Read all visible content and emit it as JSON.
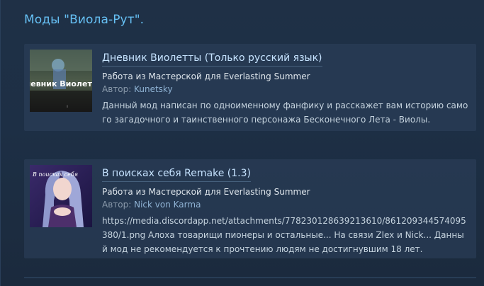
{
  "section": {
    "title": "Моды \"Виола-Рут\"."
  },
  "mods": [
    {
      "title": "Дневник Виолетты (Только русский язык)",
      "workshop": "Работа из Мастерской для Everlasting Summer",
      "author_label": "Автор:",
      "author": "Kunetsky",
      "description": "Данный мод написан по одноименному фанфику и расскажет вам историю самого загадочного и таинственного персонажа Бесконечного Лета - Виолы.",
      "thumb_text": "Дневник Виолетты"
    },
    {
      "title": "В поисках себя Remake (1.3)",
      "workshop": "Работа из Мастерской для Everlasting Summer",
      "author_label": "Автор:",
      "author": "Nick von Karma",
      "description": "https://media.discordapp.net/attachments/778230128639213610/861209344574095380/1.png Алоха товарищи пионеры и остальные... На связи Zlex и Nick... Данный мод не рекомендуется к прочтению людям не достигнувшим 18 лет.",
      "thumb_text": "В поисках себя"
    }
  ],
  "colors": {
    "accent": "#66c0f4",
    "background": "#1b2838"
  }
}
